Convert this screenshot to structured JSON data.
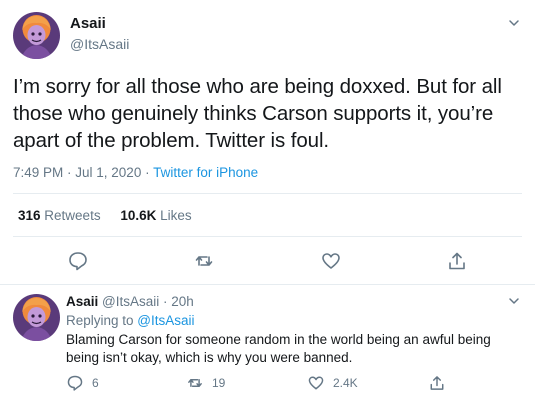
{
  "tweet": {
    "display_name": "Asaii",
    "handle": "@ItsAsaii",
    "text": "I’m sorry for all those who are being doxxed. But for all those who genuinely thinks Carson supports it, you’re apart of the problem. Twitter is foul.",
    "time": "7:49 PM · Jul 1, 2020 · ",
    "source": "Twitter for iPhone",
    "retweets_count": "316",
    "retweets_label": "Retweets",
    "likes_count": "10.6K",
    "likes_label": "Likes"
  },
  "reply": {
    "display_name": "Asaii",
    "handle_time": "@ItsAsaii · 20h",
    "replying_prefix": "Replying to ",
    "replying_to": "@ItsAsaii",
    "text": "Blaming Carson for someone random in the world being an awful being being isn’t okay, which is why you were banned.",
    "reply_count": "6",
    "retweet_count": "19",
    "like_count": "2.4K"
  },
  "icons": {
    "reply": "reply-icon",
    "retweet": "retweet-icon",
    "like": "heart-icon",
    "share": "share-icon",
    "more": "chevron-down-icon"
  },
  "colors": {
    "text": "#14171a",
    "secondary": "#657786",
    "link": "#1b95e0",
    "divider": "#e6ecf0"
  }
}
